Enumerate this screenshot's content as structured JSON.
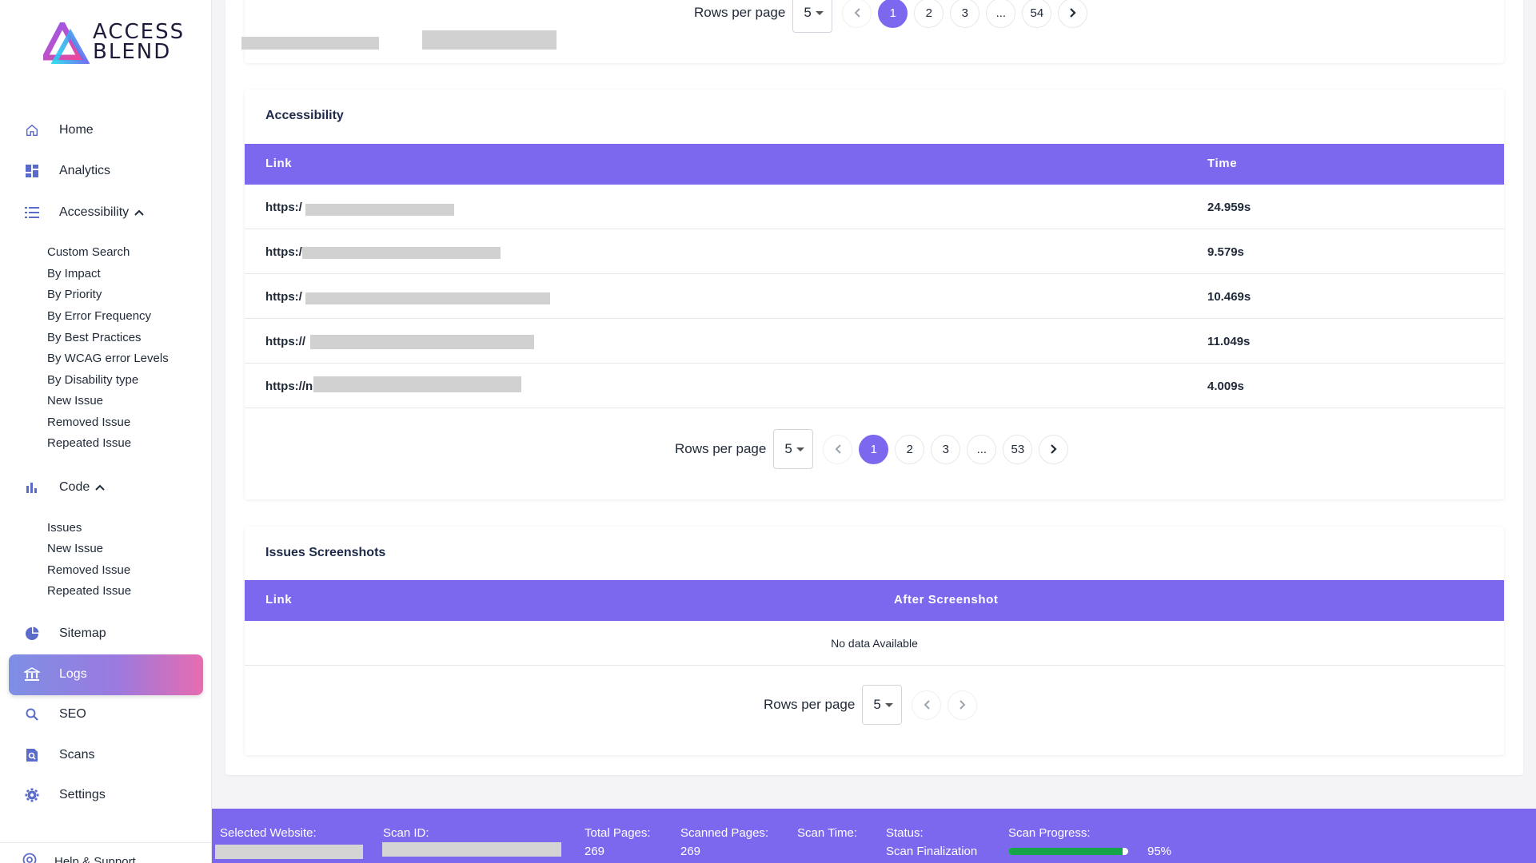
{
  "brand": {
    "line1": "ACCESS",
    "line2": "BLEND"
  },
  "sidebar": {
    "items": [
      {
        "label": "Home",
        "icon": "home-icon"
      },
      {
        "label": "Analytics",
        "icon": "dashboard-icon"
      },
      {
        "label": "Accessibility",
        "icon": "list-icon"
      },
      {
        "label": "Code",
        "icon": "bar-chart-icon"
      },
      {
        "label": "Sitemap",
        "icon": "pie-chart-icon"
      },
      {
        "label": "Logs",
        "icon": "bank-icon"
      },
      {
        "label": "SEO",
        "icon": "search-icon"
      },
      {
        "label": "Scans",
        "icon": "scan-search-icon"
      },
      {
        "label": "Settings",
        "icon": "gear-icon"
      }
    ],
    "accessibility_sub": [
      "Custom Search",
      "By Impact",
      "By Priority",
      "By Error Frequency",
      "By Best Practices",
      "By WCAG error Levels",
      "By Disability type",
      "New Issue",
      "Removed Issue",
      "Repeated Issue"
    ],
    "code_sub": [
      "Issues",
      "New Issue",
      "Removed Issue",
      "Repeated Issue"
    ],
    "active_item": "Logs",
    "help": "Help & Support"
  },
  "top_pager": {
    "rows_label": "Rows per page",
    "rows_value": "5",
    "pages": [
      "1",
      "2",
      "3",
      "...",
      "54"
    ],
    "current": "1"
  },
  "accessibility": {
    "title": "Accessibility",
    "columns": [
      "Link",
      "Time"
    ],
    "rows": [
      {
        "link": "https:/",
        "time": "24.959s"
      },
      {
        "link": "https:/",
        "time": "9.579s"
      },
      {
        "link": "https:/",
        "time": "10.469s"
      },
      {
        "link": "https://",
        "time": "11.049s"
      },
      {
        "link": "https://n",
        "time": "4.009s"
      }
    ],
    "pager": {
      "rows_label": "Rows per page",
      "rows_value": "5",
      "pages": [
        "1",
        "2",
        "3",
        "...",
        "53"
      ],
      "current": "1"
    }
  },
  "screenshots": {
    "title": "Issues Screenshots",
    "columns": [
      "Link",
      "After Screenshot"
    ],
    "empty": "No data Available",
    "pager": {
      "rows_label": "Rows per page",
      "rows_value": "5"
    }
  },
  "footer": {
    "selected_website_label": "Selected Website:",
    "scan_id_label": "Scan ID:",
    "total_pages_label": "Total Pages:",
    "total_pages": "269",
    "scanned_pages_label": "Scanned Pages:",
    "scanned_pages": "269",
    "scan_time_label": "Scan Time:",
    "status_label": "Status:",
    "status": "Scan Finalization",
    "progress_label": "Scan Progress:",
    "progress_text": "95%",
    "progress_value": 0.95
  },
  "colors": {
    "accent": "#7b68ee",
    "progress": "#16a34a",
    "icon": "#5b6bc9"
  }
}
